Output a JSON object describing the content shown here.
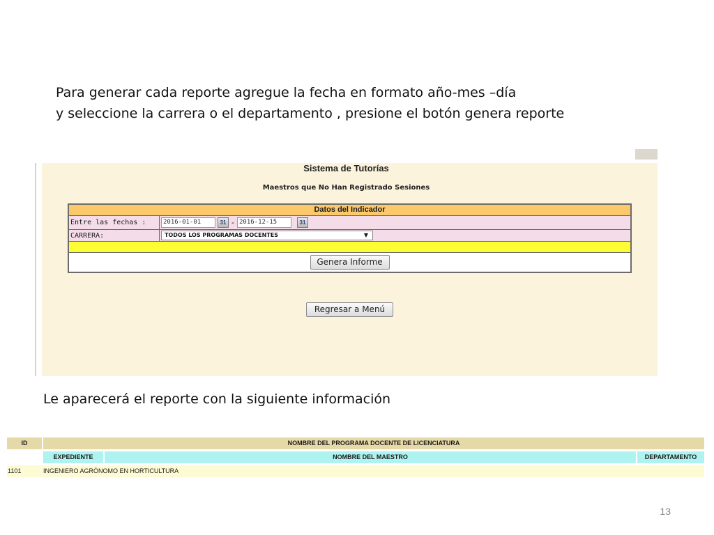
{
  "intro": {
    "line1": "Para generar cada reporte  agregue la fecha en formato año-mes –día",
    "line2": "y  seleccione la carrera o el  departamento , presione el botón genera reporte"
  },
  "app": {
    "title": "Sistema de Tutorías",
    "subtitle": "Maestros que No Han Registrado Sesiones",
    "form": {
      "header": "Datos del Indicador",
      "dates_label": "Entre las fechas :",
      "date_from": "2016-01-01",
      "date_to": "2016-12-15",
      "calendar_glyph": "31",
      "dash": "-",
      "carrera_label": "CARRERA:",
      "carrera_value": "TODOS LOS PROGRAMAS DOCENTES",
      "dropdown_arrow": "▼",
      "genera_button": "Genera Informe"
    },
    "regresar_button": "Regresar a Menú"
  },
  "subheading": "Le aparecerá el reporte  con la siguiente información",
  "report": {
    "headers": {
      "id": "ID",
      "programa": "NOMBRE DEL PROGRAMA DOCENTE DE LICENCIATURA",
      "expediente": "EXPEDIENTE",
      "maestro": "NOMBRE DEL MAESTRO",
      "departamento": "DEPARTAMENTO"
    },
    "rows": [
      {
        "id": "1101",
        "programa": "INGENIERO AGRÓNOMO EN HORTICULTURA"
      }
    ]
  },
  "slide_number": "13",
  "colors": {
    "form_header": "#fbc96a",
    "form_row": "#f4dde8",
    "yellow_row": "#fdfd33",
    "app_background": "#fbf3dc",
    "report_header": "#e5d9a7",
    "report_subheader": "#aef3ef",
    "report_row": "#fdfbd3"
  }
}
